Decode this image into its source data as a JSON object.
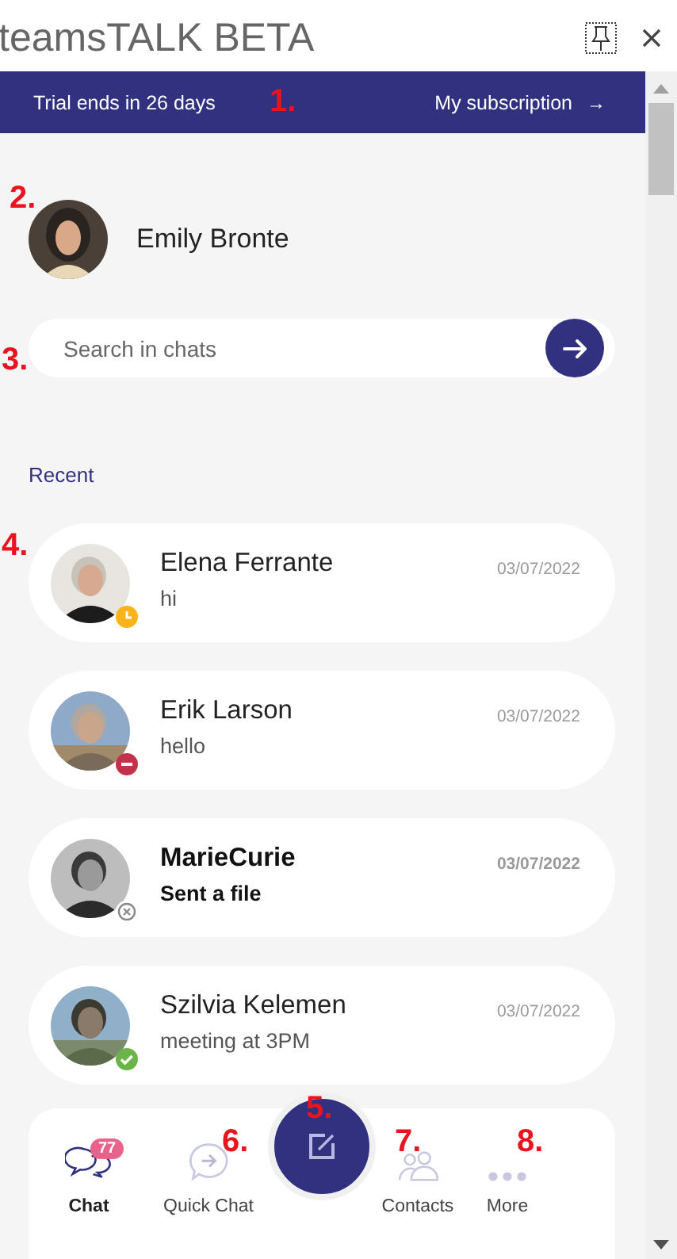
{
  "window": {
    "title": "teamsTALK BETA"
  },
  "banner": {
    "trial": "Trial ends in 26 days",
    "link": "My subscription",
    "link_arrow": "→"
  },
  "profile": {
    "name": "Emily Bronte"
  },
  "search": {
    "placeholder": "Search in chats"
  },
  "section_title": "Recent",
  "chats": [
    {
      "name": "Elena Ferrante",
      "message": "hi",
      "date": "03/07/2022",
      "unread": false,
      "presence": {
        "kind": "clock",
        "color": "#f8b418"
      }
    },
    {
      "name": "Erik Larson",
      "message": "hello",
      "date": "03/07/2022",
      "unread": false,
      "presence": {
        "kind": "minus",
        "color": "#c4314b"
      }
    },
    {
      "name": "MarieCurie",
      "message": "Sent a file",
      "date": "03/07/2022",
      "unread": true,
      "presence": {
        "kind": "cross",
        "color": "#8a8a8a"
      }
    },
    {
      "name": "Szilvia Kelemen",
      "message": "meeting at 3PM",
      "date": "03/07/2022",
      "unread": false,
      "presence": {
        "kind": "check",
        "color": "#6bb44a"
      }
    }
  ],
  "nav": [
    {
      "label": "Chat",
      "kind": "chat",
      "selected": true,
      "badge": "77"
    },
    {
      "label": "Quick Chat",
      "kind": "quick",
      "selected": false
    },
    {
      "label": "Contacts",
      "kind": "contacts",
      "selected": false
    },
    {
      "label": "More",
      "kind": "more",
      "selected": false
    }
  ],
  "annotations": [
    "1.",
    "2.",
    "3.",
    "4.",
    "5.",
    "6.",
    "7.",
    "8."
  ]
}
